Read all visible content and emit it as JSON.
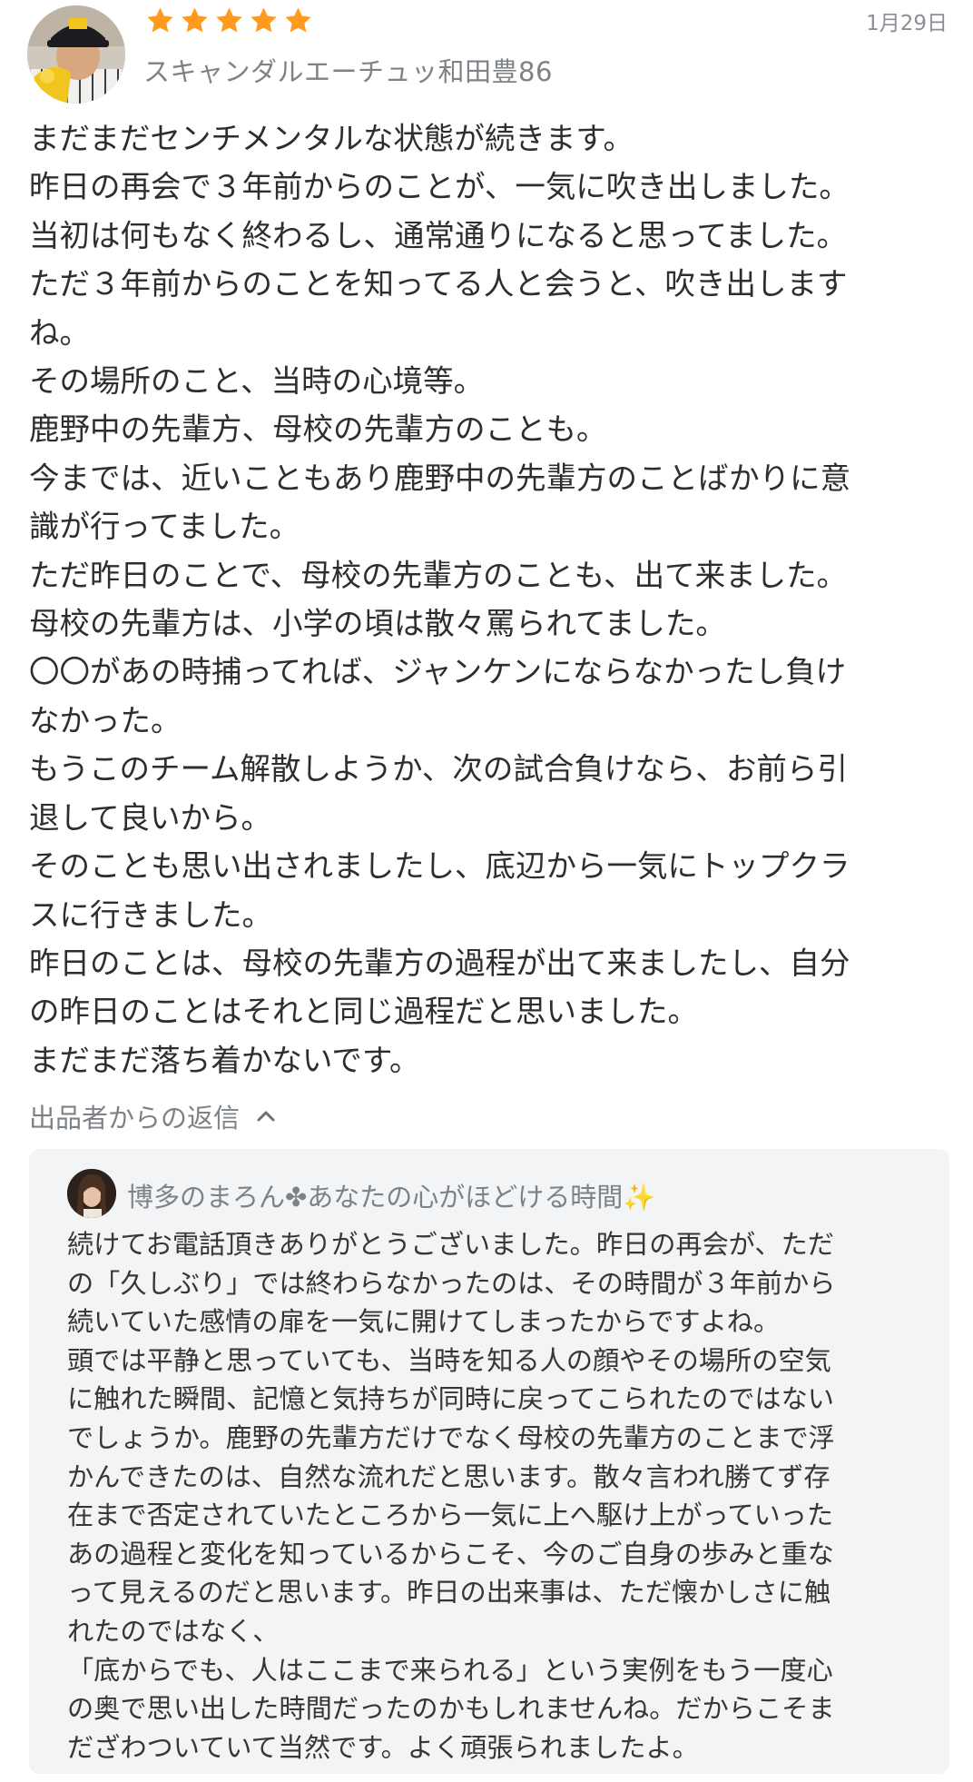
{
  "review": {
    "date": "1月29日",
    "rating": 5,
    "star_color": "#ff9a1f",
    "username": "スキャンダルエーチュッ和田豊86",
    "lines": [
      "まだまだセンチメンタルな状態が続きます。",
      "昨日の再会で３年前からのことが、一気に吹き出しました。",
      "当初は何もなく終わるし、通常通りになると思ってました。",
      "ただ３年前からのことを知ってる人と会うと、吹き出します",
      "ね。",
      "その場所のこと、当時の心境等。",
      "鹿野中の先輩方、母校の先輩方のことも。",
      "今までは、近いこともあり鹿野中の先輩方のことばかりに意",
      "識が行ってました。",
      "ただ昨日のことで、母校の先輩方のことも、出て来ました。",
      "母校の先輩方は、小学の頃は散々罵られてました。",
      "〇〇があの時捕ってれば、ジャンケンにならなかったし負け",
      "なかった。",
      "もうこのチーム解散しようか、次の試合負けなら、お前ら引",
      "退して良いから。",
      "そのことも思い出されましたし、底辺から一気にトップクラ",
      "スに行きました。",
      "昨日のことは、母校の先輩方の過程が出て来ましたし、自分",
      "の昨日のことはそれと同じ過程だと思いました。",
      "まだまだ落ち着かないです。"
    ]
  },
  "reply": {
    "toggle_label": "出品者からの返信",
    "author": "博多のまろん✤あなたの心がほどける時間",
    "author_suffix": "✨",
    "lines": [
      "続けてお電話頂きありがとうございました。昨日の再会が、ただ",
      "の「久しぶり」では終わらなかったのは、その時間が３年前から",
      "続いていた感情の扉を一気に開けてしまったからですよね。",
      "頭では平静と思っていても、当時を知る人の顔やその場所の空気",
      "に触れた瞬間、記憶と気持ちが同時に戻ってこられたのではない",
      "でしょうか。鹿野の先輩方だけでなく母校の先輩方のことまで浮",
      "かんできたのは、自然な流れだと思います。散々言われ勝てず存",
      "在まで否定されていたところから一気に上へ駆け上がっていった",
      "あの過程と変化を知っているからこそ、今のご自身の歩みと重な",
      "って見えるのだと思います。昨日の出来事は、ただ懐かしさに触",
      "れたのではなく、",
      "「底からでも、人はここまで来られる」という実例をもう一度心",
      "の奥で思い出した時間だったのかもしれませんね。だからこそま",
      "だざわついていて当然です。よく頑張られましたよ。"
    ]
  }
}
